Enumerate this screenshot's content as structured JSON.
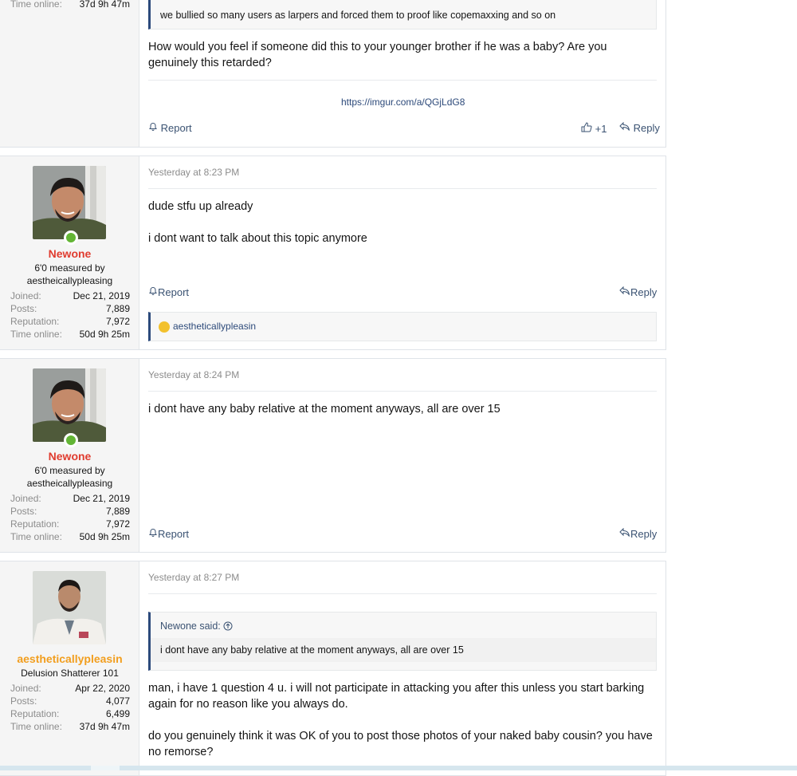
{
  "post0": {
    "time_online_label": "Time online:",
    "time_online_value": "37d 9h 47m",
    "quote_text": "we bullied so many users as larpers and forced them to proof like copemaxxing and so on",
    "body": "How would you feel if someone did this to your younger brother if he was a baby? Are you genuinely this retarded?",
    "link": "https://imgur.com/a/QGjLdG8",
    "report": "Report",
    "like_count": "+1",
    "reply": "Reply"
  },
  "post1": {
    "username": "Newone",
    "title_line1": "6'0 measured by",
    "title_line2": "aestheicallypleasing",
    "stats": [
      {
        "k": "Joined:",
        "v": "Dec 21, 2019"
      },
      {
        "k": "Posts:",
        "v": "7,889"
      },
      {
        "k": "Reputation:",
        "v": "7,972"
      },
      {
        "k": "Time online:",
        "v": "50d 9h 25m"
      }
    ],
    "date": "Yesterday at 8:23 PM",
    "line1": "dude stfu up already",
    "line2": "i dont want to talk about this topic anymore",
    "report": "Report",
    "reply": "Reply",
    "reaction_user": "aesthetically​pleasin"
  },
  "post2": {
    "username": "Newone",
    "title_line1": "6'0 measured by",
    "title_line2": "aestheicallypleasing",
    "stats": [
      {
        "k": "Joined:",
        "v": "Dec 21, 2019"
      },
      {
        "k": "Posts:",
        "v": "7,889"
      },
      {
        "k": "Reputation:",
        "v": "7,972"
      },
      {
        "k": "Time online:",
        "v": "50d 9h 25m"
      }
    ],
    "date": "Yesterday at 8:24 PM",
    "line1": "i dont have any baby relative at the moment anyways, all are over 15",
    "report": "Report",
    "reply": "Reply"
  },
  "post3": {
    "username": "aestheticallypleasin",
    "title_line1": "Delusion Shatterer 101",
    "stats": [
      {
        "k": "Joined:",
        "v": "Apr 22, 2020"
      },
      {
        "k": "Posts:",
        "v": "4,077"
      },
      {
        "k": "Reputation:",
        "v": "6,499"
      },
      {
        "k": "Time online:",
        "v": "37d 9h 47m"
      }
    ],
    "date": "Yesterday at 8:27 PM",
    "quote_author": "Newone said:",
    "quote_text": "i dont have any baby relative at the moment anyways, all are over 15",
    "para1": "man, i have 1 question 4 u. i will not participate in attacking you after this unless you start barking again for no reason like you always do.",
    "para2": "do you genuinely think it was OK of you to post those photos of your naked baby cousin? you have no remorse?"
  }
}
